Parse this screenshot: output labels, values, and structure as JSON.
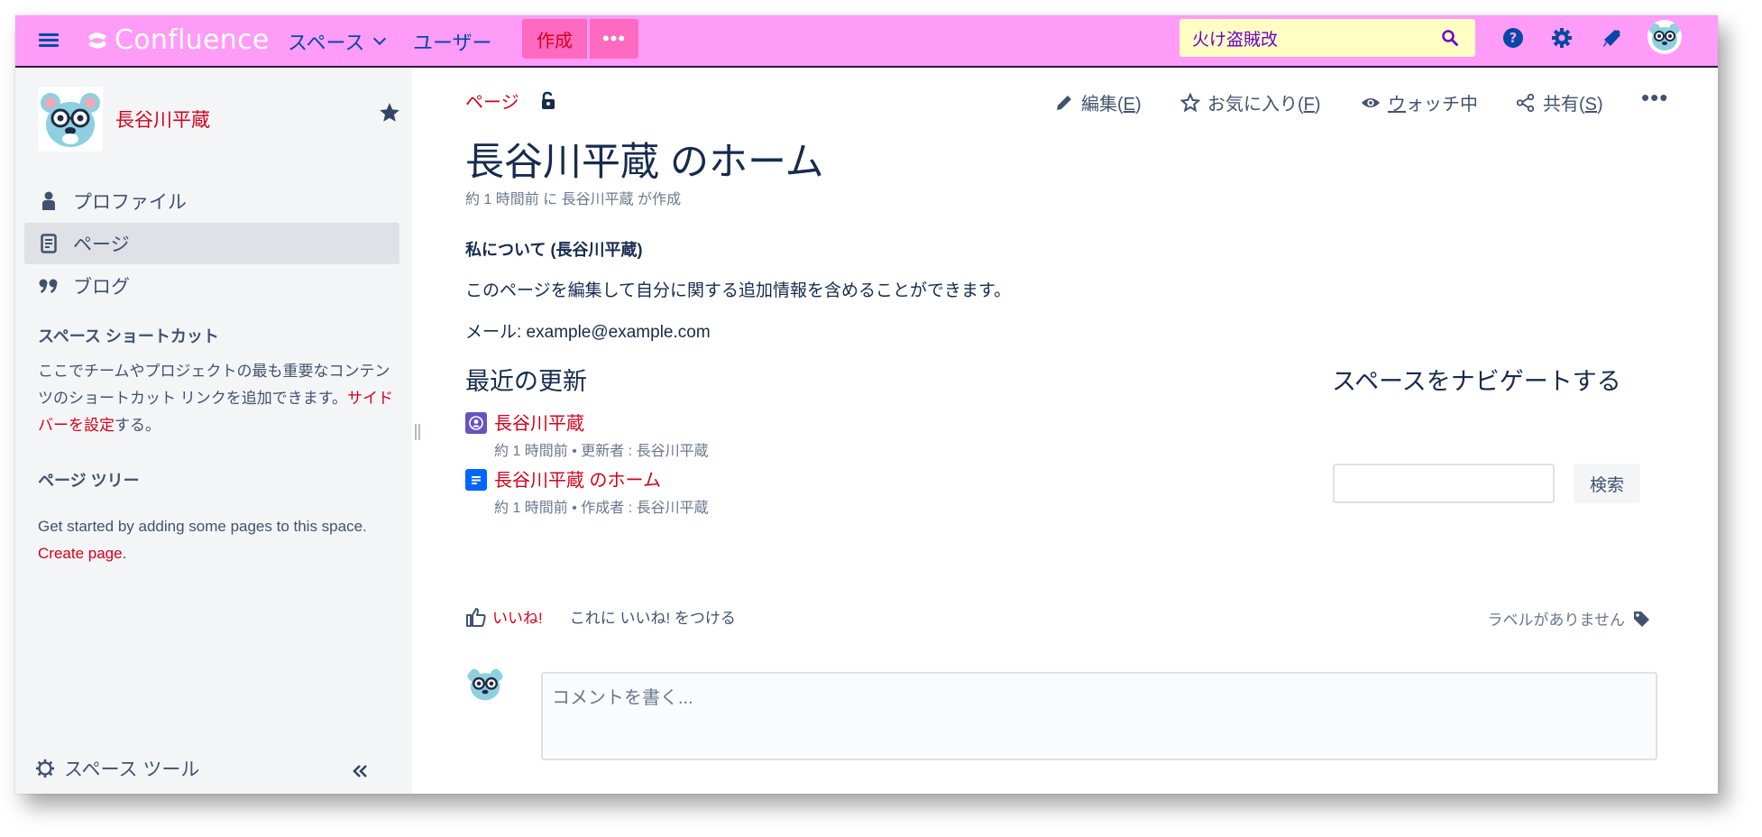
{
  "topbar": {
    "logo": "Confluence",
    "nav_spaces": "スペース",
    "nav_users": "ユーザー",
    "create": "作成",
    "more": "•••",
    "search_value": "火け盗賊改",
    "bg_color": "#ff9cf7"
  },
  "sidebar": {
    "space_name": "長谷川平蔵",
    "items": [
      {
        "label": "プロファイル",
        "icon": "person-icon"
      },
      {
        "label": "ページ",
        "icon": "page-icon"
      },
      {
        "label": "ブログ",
        "icon": "quote-icon"
      }
    ],
    "shortcuts_title": "スペース ショートカット",
    "shortcuts_text_before": "ここでチームやプロジェクトの最も重要なコンテンツのショートカット リンクを追加できます。",
    "shortcuts_link": "サイドバーを設定",
    "shortcuts_text_after": "する。",
    "pagetree_title": "ページ ツリー",
    "pagetree_text": "Get started by adding some pages to this space.",
    "pagetree_link": "Create page",
    "pagetree_period": ".",
    "space_tools": "スペース ツール"
  },
  "page": {
    "breadcrumb": "ページ",
    "actions": {
      "edit_prefix": "編集(",
      "edit_key": "E",
      "fav_prefix": "お気に入り(",
      "fav_key": "F",
      "watch_key": "ウ",
      "watch_rest": "ォッチ中",
      "share_prefix": "共有(",
      "share_key": "S",
      "close_paren": ")",
      "more": "•••"
    },
    "title": "長谷川平蔵 のホーム",
    "byline": "約 1 時間前 に 長谷川平蔵 が作成",
    "about_heading": "私について (長谷川平蔵)",
    "para1": "このページを編集して自分に関する追加情報を含めることができます。",
    "para2": "メール: example@example.com",
    "recent_heading": "最近の更新",
    "updates": [
      {
        "title": "長谷川平蔵",
        "meta": "約 1 時間前 • 更新者 : 長谷川平蔵",
        "icon": "profile-icon"
      },
      {
        "title": "長谷川平蔵 のホーム",
        "meta": "約 1 時間前 • 作成者 : 長谷川平蔵",
        "icon": "document-icon"
      }
    ],
    "navigate_heading": "スペースをナビゲートする",
    "navigate_search_button": "検索",
    "like": "いいね!",
    "like_hint": "これに いいね! をつける",
    "labels": "ラベルがありません",
    "comment_placeholder": "コメントを書く..."
  }
}
